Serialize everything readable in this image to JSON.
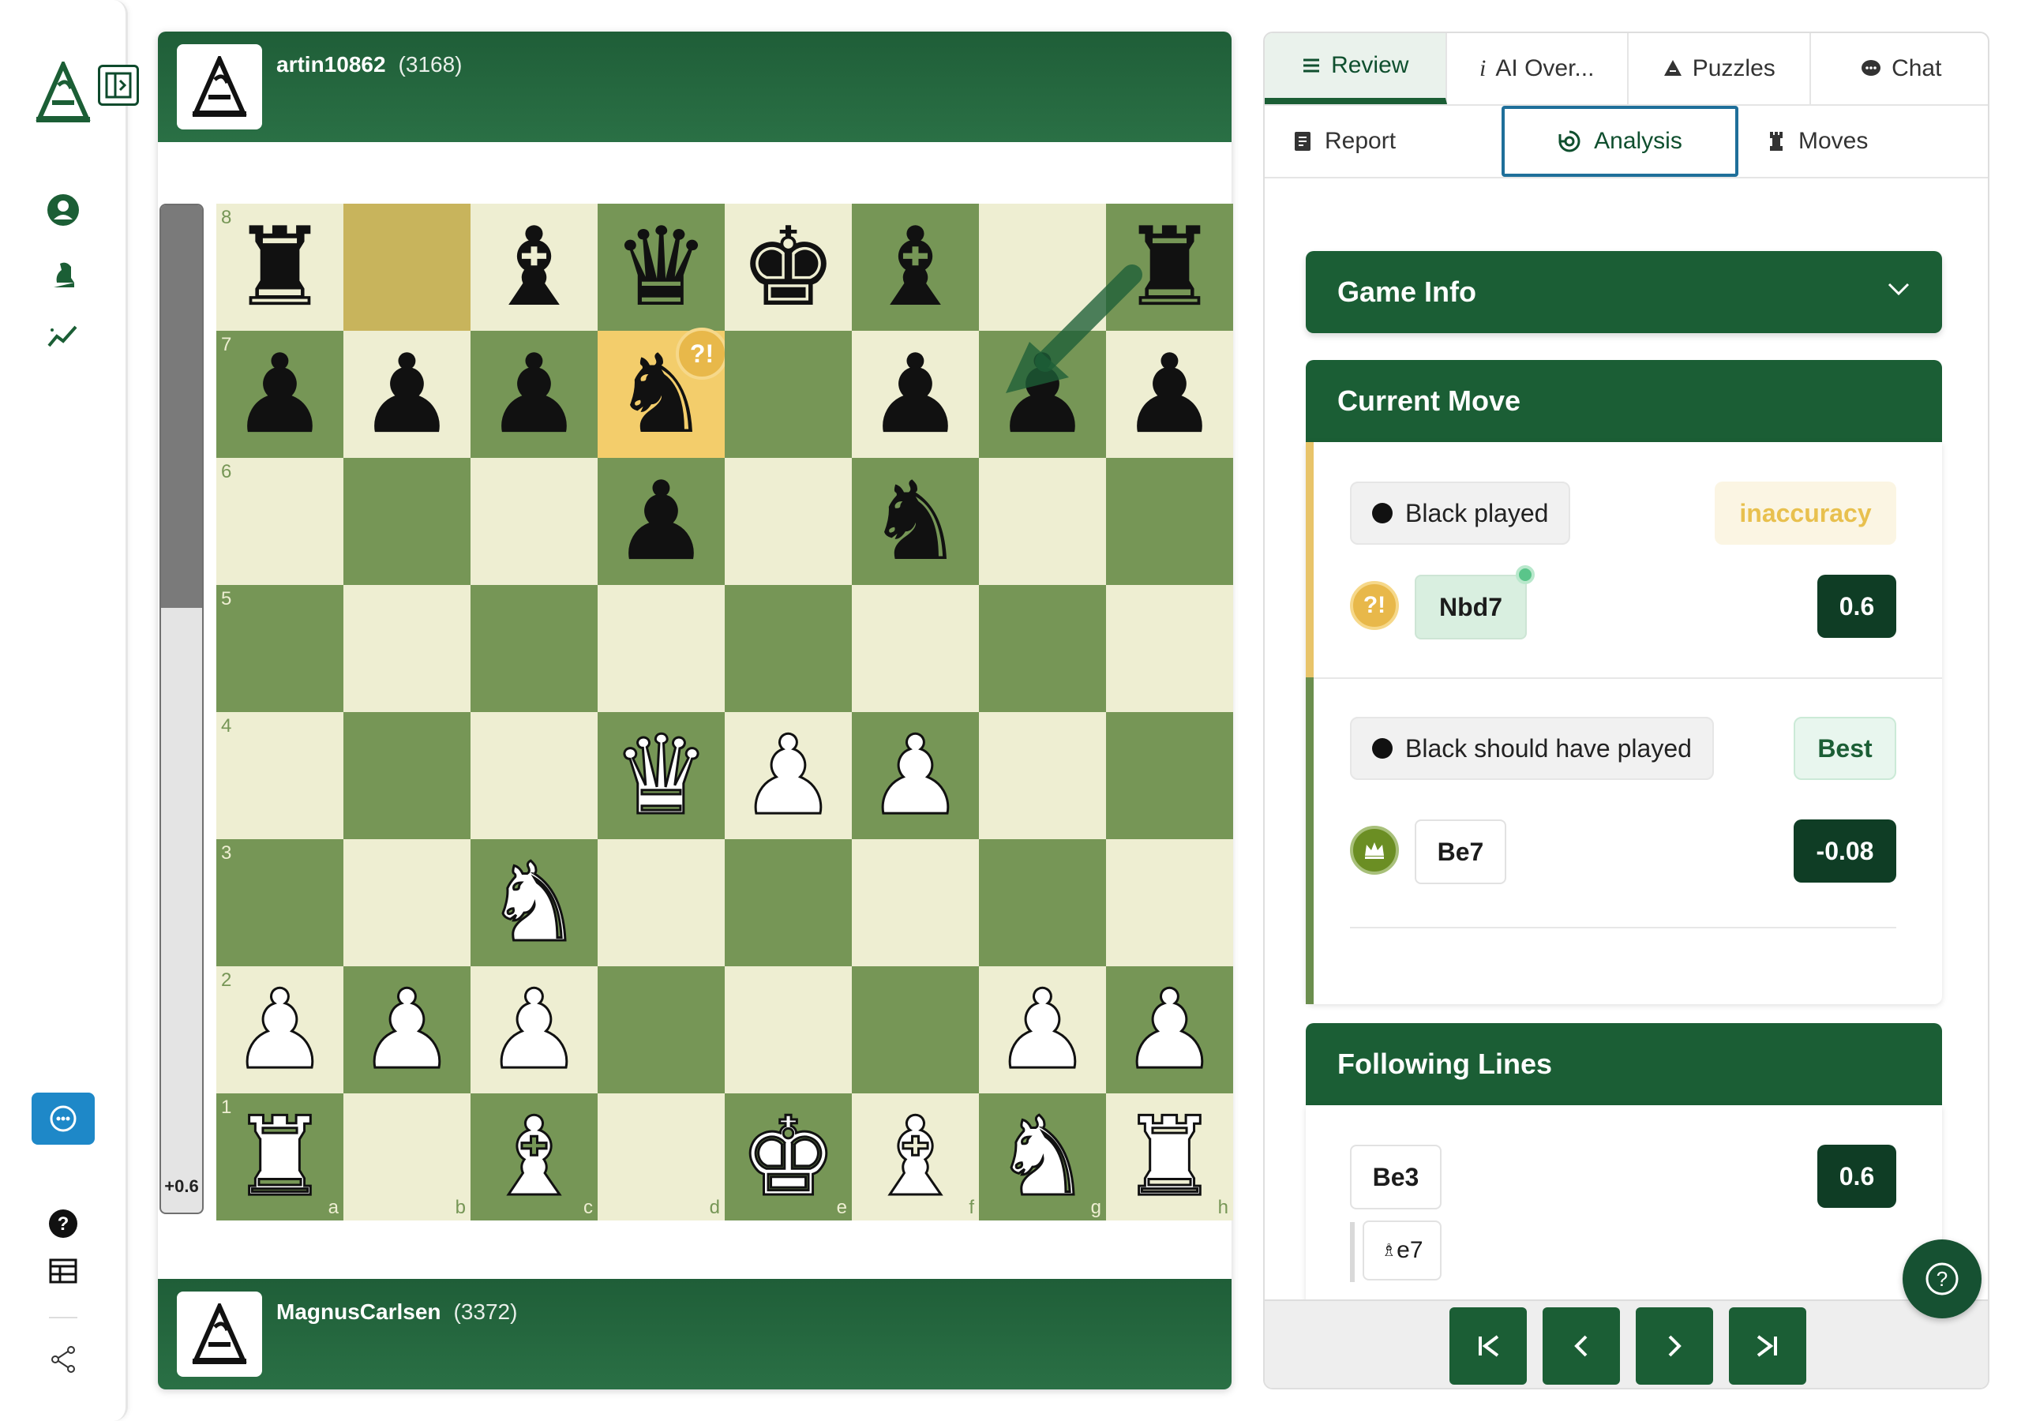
{
  "players": {
    "top": {
      "name": "artin10862",
      "rating": "(3168)"
    },
    "bottom": {
      "name": "MagnusCarlsen",
      "rating": "(3372)"
    }
  },
  "eval": {
    "label": "+0.6",
    "white_share": 0.6
  },
  "board": {
    "files": [
      "a",
      "b",
      "c",
      "d",
      "e",
      "f",
      "g",
      "h"
    ],
    "ranks": [
      "8",
      "7",
      "6",
      "5",
      "4",
      "3",
      "2",
      "1"
    ],
    "position": [
      [
        "br",
        "",
        "bb",
        "bq",
        "bk",
        "bb",
        "",
        "br"
      ],
      [
        "bp",
        "bp",
        "bp",
        "bn",
        "",
        "bp",
        "bp",
        "bp"
      ],
      [
        "",
        "",
        "",
        "bp",
        "",
        "bn",
        "",
        ""
      ],
      [
        "",
        "",
        "",
        "",
        "",
        "",
        "",
        ""
      ],
      [
        "",
        "",
        "",
        "wq",
        "wp",
        "wp",
        "",
        ""
      ],
      [
        "",
        "",
        "wn",
        "",
        "",
        "",
        "",
        ""
      ],
      [
        "wp",
        "wp",
        "wp",
        "",
        "",
        "",
        "wp",
        "wp"
      ],
      [
        "wr",
        "",
        "wb",
        "",
        "wk",
        "wb",
        "wn",
        "wr"
      ]
    ],
    "last_move": {
      "from": "b8",
      "to": "d7"
    },
    "badge": "?!",
    "colors": {
      "light": "#eeeed2",
      "dark": "#769656",
      "highlight_from": "#c8b45c",
      "highlight_to": "#f3cd6b"
    }
  },
  "tabs": {
    "primary": [
      {
        "icon": "list-icon",
        "label": "Review",
        "active": true
      },
      {
        "icon": "info-icon",
        "label": "AI Over...",
        "active": false
      },
      {
        "icon": "puzzle-icon",
        "label": "Puzzles",
        "active": false
      },
      {
        "icon": "chat-icon",
        "label": "Chat",
        "active": false
      }
    ],
    "secondary": [
      {
        "icon": "report-icon",
        "label": "Report",
        "active": false
      },
      {
        "icon": "analysis-icon",
        "label": "Analysis",
        "active": true
      },
      {
        "icon": "rook-icon",
        "label": "Moves",
        "active": false
      }
    ]
  },
  "game_info": {
    "title": "Game Info"
  },
  "current_move": {
    "title": "Current Move",
    "played": {
      "label": "Black played",
      "classification": "inaccuracy",
      "move": "Nbd7",
      "score": "0.6",
      "badge": "?!"
    },
    "best": {
      "label": "Black should have played",
      "classification": "Best",
      "move": "Be7",
      "score": "-0.08"
    }
  },
  "following_lines": {
    "title": "Following Lines",
    "lines": [
      {
        "move": "Be3",
        "score": "0.6",
        "continuation": "e7"
      }
    ]
  },
  "accent_colors": {
    "primary_green": "#1b5e35",
    "inaccuracy": "#e8b84a",
    "best": "#6b8e23"
  }
}
